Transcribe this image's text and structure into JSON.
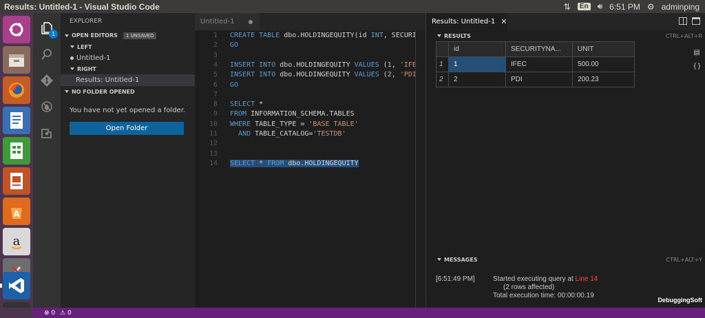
{
  "window_title": "Results: Untitled-1 - Visual Studio Code",
  "system": {
    "keyboard": "En",
    "time": "6:51 PM",
    "user": "adminping"
  },
  "explorer": {
    "header": "EXPLORER",
    "open_editors_label": "OPEN EDITORS",
    "unsaved_badge": "1 UNSAVED",
    "left_label": "LEFT",
    "left_file": "Untitled-1",
    "right_label": "RIGHT",
    "right_file": "Results: Untitled-1",
    "no_folder_label": "NO FOLDER OPENED",
    "no_folder_message": "You have not yet opened a folder.",
    "open_folder_button": "Open Folder"
  },
  "activity_badge": "1",
  "editor": {
    "tab_label": "Untitled-1",
    "line_numbers": [
      "1",
      "2",
      "3",
      "4",
      "5",
      "6",
      "7",
      "8",
      "9",
      "10",
      "11",
      "12",
      "13",
      "14"
    ]
  },
  "results_pane": {
    "tab_label": "Results: Untitled-1",
    "results_header": "RESULTS",
    "results_shortcut": "CTRL+ALT+R",
    "columns": [
      "id",
      "SECURITYNA...",
      "UNIT"
    ],
    "rows": [
      {
        "row": "1",
        "id": "1",
        "security": "IFEC",
        "unit": "500.00"
      },
      {
        "row": "2",
        "id": "2",
        "security": "PDI",
        "unit": "200.23"
      }
    ],
    "messages_header": "MESSAGES",
    "messages_shortcut": "CTRL+ALT+Y",
    "message_time": "[6:51:49 PM]",
    "message_line1_prefix": "Started executing query at ",
    "message_line1_link": "Line 14",
    "message_line2": "(2 rows affected)",
    "message_line3": "Total execution time: 00:00:00.19",
    "watermark": "DebuggingSoft"
  },
  "status": {
    "errors": "0",
    "warnings": "0"
  },
  "colors": {
    "status_bar": "#68217a",
    "keyword": "#569cd6",
    "string": "#ce9178",
    "link": "#f14c4c",
    "selection": "#264f78"
  }
}
